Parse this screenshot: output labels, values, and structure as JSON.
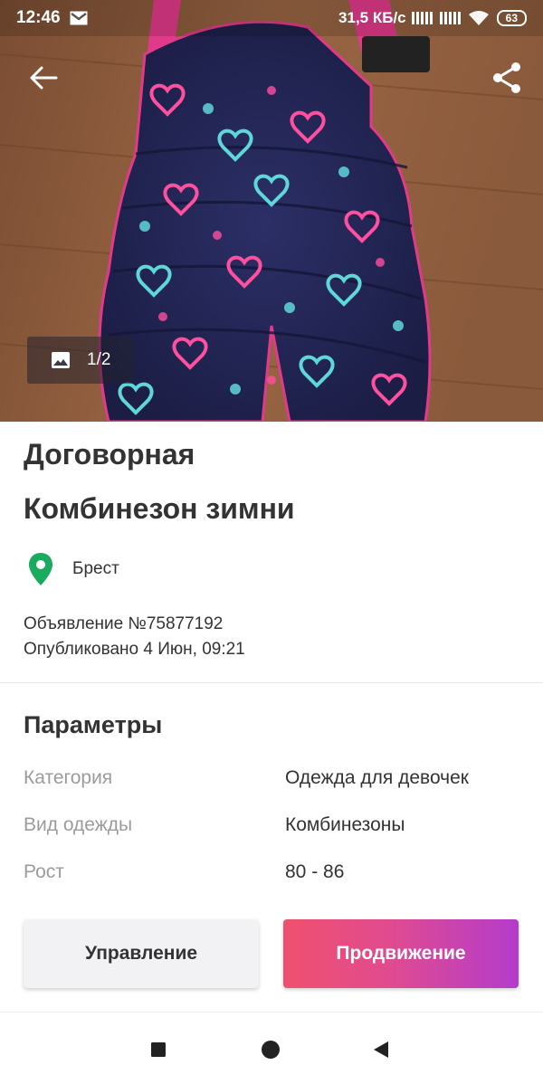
{
  "status_bar": {
    "time": "12:46",
    "network_speed": "31,5 КБ/с",
    "battery": "63",
    "icons": [
      "gmail-icon",
      "signal-icon",
      "signal-icon",
      "wifi-icon",
      "battery-icon"
    ]
  },
  "toolbar": {
    "back_icon": "arrow-left-icon",
    "share_icon": "share-icon"
  },
  "gallery": {
    "counter": "1/2",
    "icon": "image-icon"
  },
  "ad": {
    "price": "Договорная",
    "title": "Комбинезон зимни",
    "location": "Брест",
    "ad_number": "Объявление №75877192",
    "published": "Опубликовано 4 Июн, 09:21"
  },
  "params": {
    "title": "Параметры",
    "rows": [
      {
        "key": "Категория",
        "value": "Одежда для девочек"
      },
      {
        "key": "Вид одежды",
        "value": "Комбинезоны"
      },
      {
        "key": "Рост",
        "value": "80 - 86"
      }
    ]
  },
  "actions": {
    "manage_label": "Управление",
    "promote_label": "Продвижение"
  },
  "colors": {
    "pin": "#1aab5e",
    "promote_start": "#f0506e",
    "promote_end": "#b43ccc"
  },
  "navbar": {
    "icons": [
      "recents-square-icon",
      "home-circle-icon",
      "back-triangle-icon"
    ]
  }
}
